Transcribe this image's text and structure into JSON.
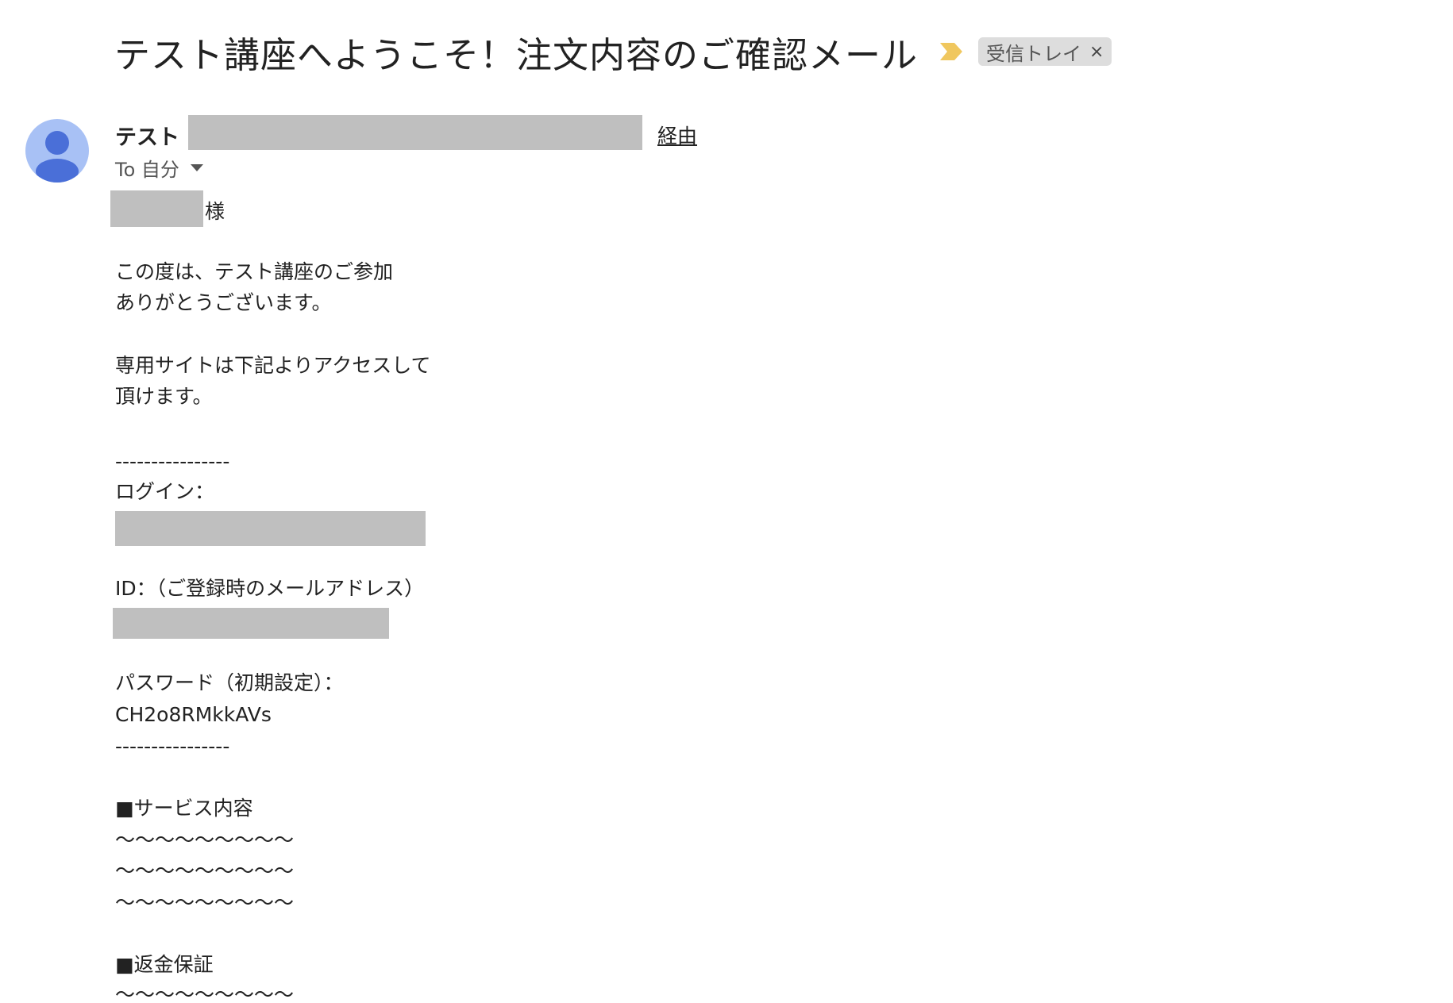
{
  "email": {
    "subject": "テスト講座へようこそ！注文内容のご確認メール",
    "label": "受信トレイ",
    "label_close": "×",
    "importance_color": "#f0c75e",
    "sender_name": "テスト",
    "via_text": "経由",
    "recipient": "To 自分",
    "avatar_color": "#a8c1f5",
    "avatar_icon": "person-icon"
  },
  "body": {
    "salutation_suffix": "様",
    "intro_line1": "この度は、テスト講座のご参加",
    "intro_line2": "ありがとうございます。",
    "access_line1": "専用サイトは下記よりアクセスして",
    "access_line2": "頂けます。",
    "divider": "----------------",
    "login_label": "ログイン：",
    "id_label": "ID：（ご登録時のメールアドレス）",
    "password_label": "パスワード（初期設定）：",
    "password_value": "CH2o8RMkkAVs",
    "service_heading": "■サービス内容",
    "wave_line": "〜〜〜〜〜〜〜〜〜",
    "refund_heading": "■返金保証"
  }
}
